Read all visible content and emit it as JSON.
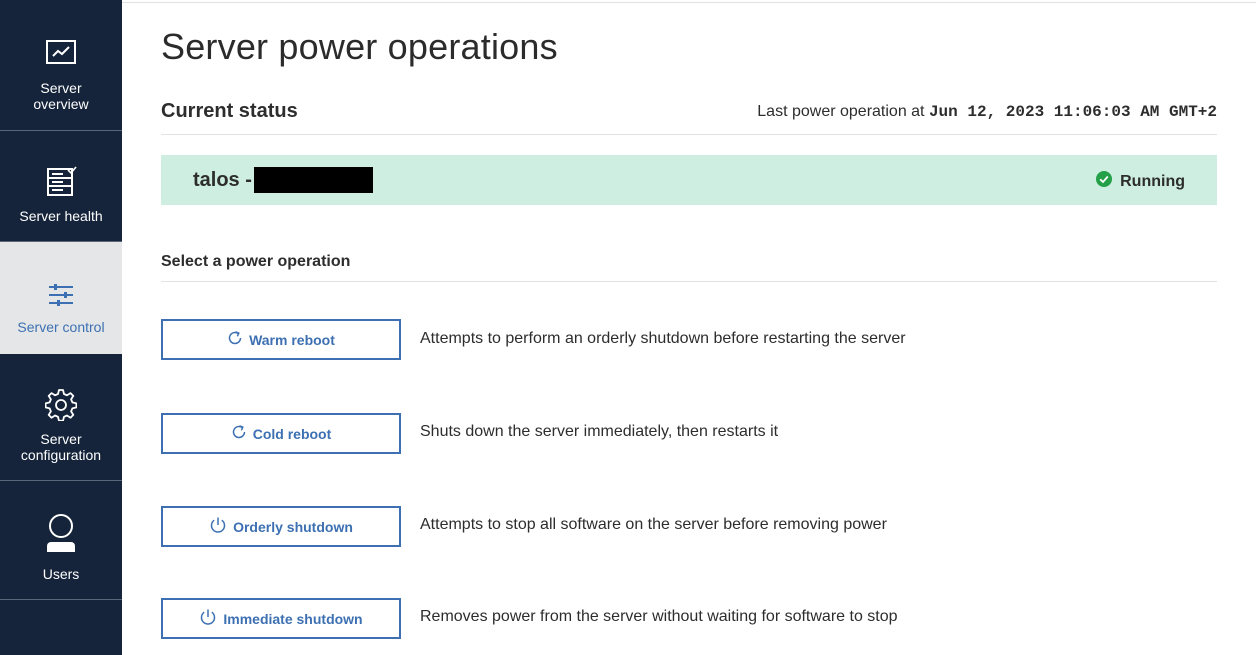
{
  "sidebar": {
    "items": [
      {
        "label_line1": "Server",
        "label_line2": "overview",
        "icon": "monitor-icon"
      },
      {
        "label_line1": "Server health",
        "label_line2": "",
        "icon": "server-health-icon"
      },
      {
        "label_line1": "Server control",
        "label_line2": "",
        "icon": "sliders-icon",
        "active": true
      },
      {
        "label_line1": "Server",
        "label_line2": "configuration",
        "icon": "gear-icon"
      },
      {
        "label_line1": "Users",
        "label_line2": "",
        "icon": "user-icon"
      }
    ]
  },
  "page": {
    "title": "Server power operations"
  },
  "status": {
    "header": "Current status",
    "last_op_label": "Last power operation at",
    "last_op_time": "Jun 12, 2023 11:06:03 AM GMT+2",
    "host_prefix": "talos -",
    "state": "Running",
    "state_color": "#24a148",
    "bar_color": "#cdeee0"
  },
  "operations": {
    "header": "Select a power operation",
    "items": [
      {
        "label": "Warm reboot",
        "icon": "refresh-icon",
        "description": "Attempts to perform an orderly shutdown before restarting the server"
      },
      {
        "label": "Cold reboot",
        "icon": "refresh-icon",
        "description": "Shuts down the server immediately, then restarts it"
      },
      {
        "label": "Orderly shutdown",
        "icon": "power-icon",
        "description": "Attempts to stop all software on the server before removing power"
      },
      {
        "label": "Immediate shutdown",
        "icon": "power-icon",
        "description": "Removes power from the server without waiting for software to stop"
      }
    ]
  },
  "colors": {
    "sidebar_bg": "#15243a",
    "accent": "#3d70b2",
    "active_bg": "#e5e6e8"
  }
}
